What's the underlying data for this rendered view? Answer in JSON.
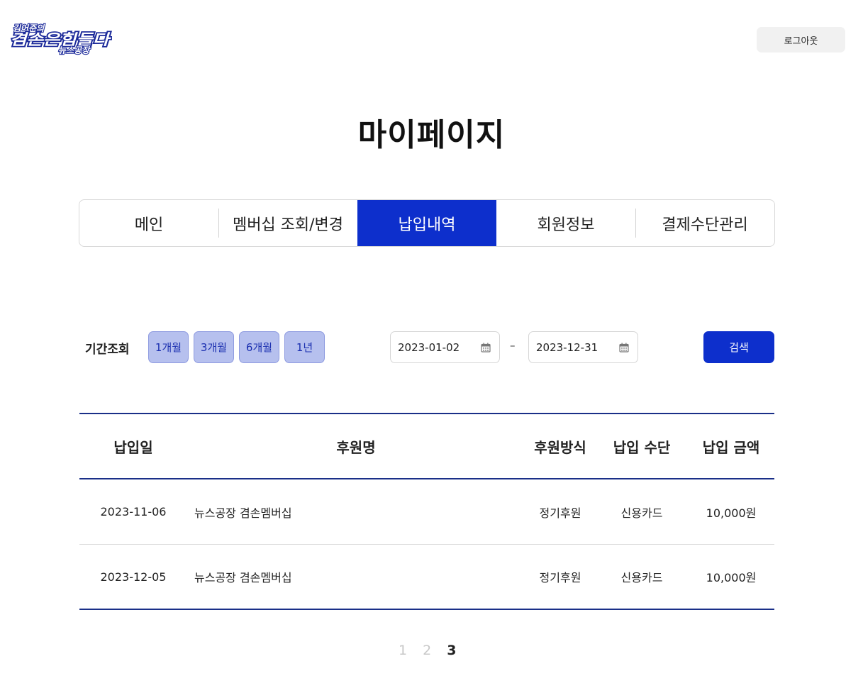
{
  "header": {
    "logo_text_small": "김어준의",
    "logo_text_main": "겸손은힘들다",
    "logo_text_sub": "뉴스공장",
    "logout_label": "로그아웃"
  },
  "page_title": "마이페이지",
  "tabs": [
    {
      "label": "메인",
      "active": false
    },
    {
      "label": "멤버십 조회/변경",
      "active": false
    },
    {
      "label": "납입내역",
      "active": true
    },
    {
      "label": "회원정보",
      "active": false
    },
    {
      "label": "결제수단관리",
      "active": false
    }
  ],
  "filter": {
    "label": "기간조회",
    "periods": [
      "1개월",
      "3개월",
      "6개월",
      "1년"
    ],
    "start_date": "2023-01-02",
    "end_date": "2023-12-31",
    "separator": "–",
    "search_label": "검색"
  },
  "table": {
    "headers": {
      "date": "납입일",
      "name": "후원명",
      "type": "후원방식",
      "method": "납입 수단",
      "amount": "납입 금액"
    },
    "rows": [
      {
        "date": "2023-11-06",
        "name": "뉴스공장 겸손멤버십",
        "type": "정기후원",
        "method": "신용카드",
        "amount": "10,000원"
      },
      {
        "date": "2023-12-05",
        "name": "뉴스공장 겸손멤버십",
        "type": "정기후원",
        "method": "신용카드",
        "amount": "10,000원"
      }
    ]
  },
  "pagination": {
    "pages": [
      "1",
      "2",
      "3"
    ],
    "current": "3"
  },
  "colors": {
    "primary": "#0d2fcc",
    "period_button_bg": "#b6c0ee",
    "table_border": "#1a2f88"
  }
}
